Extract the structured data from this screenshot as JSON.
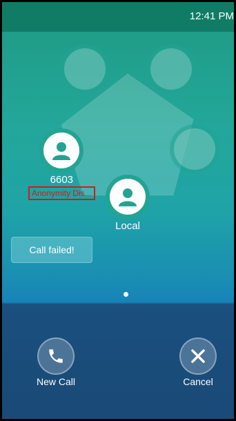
{
  "status_bar": {
    "time": "12:41 PM"
  },
  "participants": [
    {
      "name": "6603",
      "status": "Anonymity Dis..."
    },
    {
      "name": "Local"
    }
  ],
  "notice": {
    "text": "Call failed!"
  },
  "actions": {
    "new_call_label": "New Call",
    "cancel_label": "Cancel"
  },
  "colors": {
    "status_bar": "#117c66",
    "avatar": "#23a394",
    "error": "#d01c1c"
  }
}
